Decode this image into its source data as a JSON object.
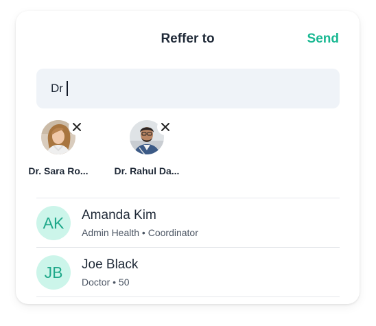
{
  "header": {
    "title": "Reffer to",
    "send_label": "Send"
  },
  "search": {
    "value": "Dr"
  },
  "selected": [
    {
      "name": "Dr. Sara Ro...",
      "avatar_icon": "user-photo-woman"
    },
    {
      "name": "Dr. Rahul Da...",
      "avatar_icon": "user-photo-man"
    }
  ],
  "contacts": [
    {
      "initials": "AK",
      "name": "Amanda Kim",
      "subtitle": "Admin Health • Coordinator"
    },
    {
      "initials": "JB",
      "name": "Joe Black",
      "subtitle": "Doctor • 50"
    }
  ],
  "colors": {
    "accent": "#19b892",
    "avatar_bg": "#ccf5ea",
    "avatar_text": "#1fa88a",
    "search_bg": "#eff3f8"
  }
}
